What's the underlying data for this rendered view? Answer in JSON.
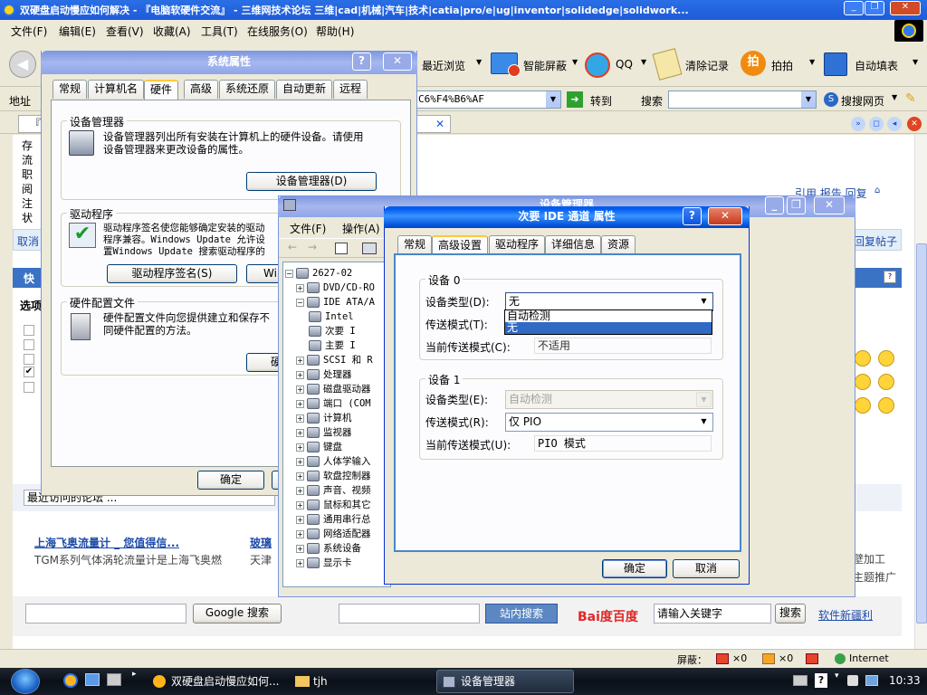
{
  "browser": {
    "title": "双硬盘启动慢应如何解决 - 『电脑软硬件交流』 - 三维网技术论坛 三维|cad|机械|汽车|技术|catia|pro/e|ug|inventor|solidedge|solidwork...",
    "menu": [
      "文件(F)",
      "编辑(E)",
      "查看(V)",
      "收藏(A)",
      "工具(T)",
      "在线服务(O)",
      "帮助(H)"
    ],
    "toolbar": [
      "最近浏览",
      "智能屏蔽",
      "QQ",
      "清除记录",
      "拍拍",
      "自动填表"
    ],
    "address_label": "地址",
    "address_value": "C6%F4%B6%AF",
    "go_label": "转到",
    "search_label": "搜索",
    "search_web": "搜搜网页",
    "tab_partial": "『",
    "side_items": [
      "存",
      "流",
      "职",
      "阅",
      "注",
      "状"
    ],
    "cancel_link": "取消",
    "reply_links": "引用 报告 回复",
    "reply_post": "回复帖子",
    "quick": "快",
    "options": "选项",
    "recent_dropdown": "最近访问的论坛 ...",
    "ad1_title": "上海飞奥流量计 _ 您值得信...",
    "ad1_desc": "TGM系列气体涡轮流量计是上海飞奥燃",
    "ad2_title": "玻璃",
    "ad2_desc": "天津",
    "right_texts": [
      "壁加工",
      "主题推广"
    ],
    "google_btn": "Google 搜索",
    "site_search_btn": "站内搜索",
    "baidu_logo": "Bai度百度",
    "baidu_input": "请输入关键字",
    "baidu_search": "搜索",
    "new_software": "软件新疆利",
    "status": {
      "block": "屏蔽：",
      "x0a": "×0",
      "x0b": "×0",
      "zone": "Internet"
    }
  },
  "taskbar": {
    "items": [
      "双硬盘启动慢应如何...",
      "tjh",
      "设备管理器"
    ],
    "time": "10:33"
  },
  "sysprop": {
    "title": "系统属性",
    "tabs": [
      "常规",
      "计算机名",
      "硬件",
      "高级",
      "系统还原",
      "自动更新",
      "远程"
    ],
    "devmgr_group": "设备管理器",
    "devmgr_desc": "设备管理器列出所有安装在计算机上的硬件设备。请使用设备管理器来更改设备的属性。",
    "devmgr_btn": "设备管理器(D)",
    "driver_group": "驱动程序",
    "driver_desc": "驱动程序签名使您能够确定安装的驱动程序兼容。Windows Update 允许设置Windows Update 搜索驱动程序的方式。",
    "driver_sign_btn": "驱动程序签名(S)",
    "wu_btn": "Wi",
    "hwprofile_group": "硬件配置文件",
    "hwprofile_desc": "硬件配置文件向您提供建立和保存不同硬件配置的方法。",
    "hwprofile_btn": "硬",
    "ok": "确定",
    "cancel": ""
  },
  "devmgr": {
    "title": "设备管理器",
    "menu": [
      "文件(F)",
      "操作(A)"
    ],
    "tree": [
      "2627-02",
      "DVD/CD-RO",
      "IDE ATA/A",
      "Intel",
      "次要 I",
      "主要 I",
      "SCSI 和 R",
      "处理器",
      "磁盘驱动器",
      "端口 (COM",
      "计算机",
      "监视器",
      "键盘",
      "人体学输入",
      "软盘控制器",
      "声音、视频",
      "鼠标和其它",
      "通用串行总",
      "网络适配器",
      "系统设备",
      "显示卡"
    ]
  },
  "ide": {
    "title": "次要 IDE 通道 属性",
    "tabs": [
      "常规",
      "高级设置",
      "驱动程序",
      "详细信息",
      "资源"
    ],
    "dev0": "设备 0",
    "dev1": "设备 1",
    "type_label": "设备类型(D):",
    "transfer_label": "传送模式(T):",
    "current_label": "当前传送模式(C):",
    "type_label1": "设备类型(E):",
    "transfer_label1": "传送模式(R):",
    "current_label1": "当前传送模式(U):",
    "dev0_type": "无",
    "dropdown_options": [
      "自动检测",
      "无"
    ],
    "dev0_current": "不适用",
    "dev1_type": "自动检测",
    "dev1_transfer": "仅 PIO",
    "dev1_current": "PIO 模式",
    "ok": "确定",
    "cancel": "取消"
  }
}
